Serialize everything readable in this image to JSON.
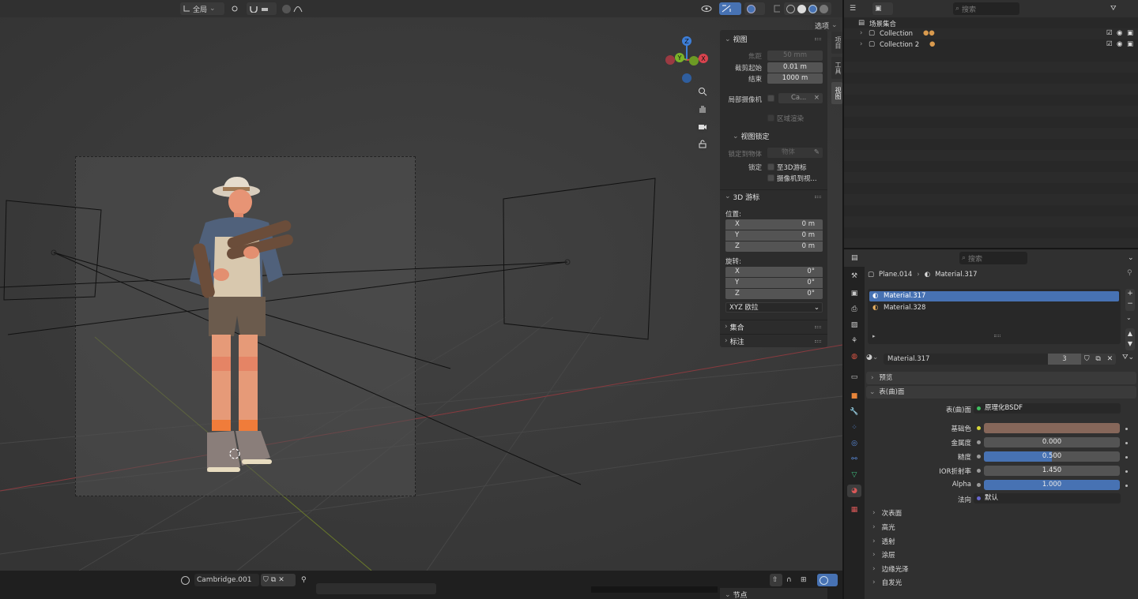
{
  "viewport": {
    "header": {
      "transform_orientation": "全局",
      "options_label": "选项"
    },
    "npanel": {
      "view_section": "视图",
      "focal_label": "焦距",
      "focal_value": "50 mm",
      "clip_start_label": "截剪起始",
      "clip_start_value": "0.01 m",
      "clip_end_label": "结束",
      "clip_end_value": "1000 m",
      "local_camera_label": "局部摄像机",
      "local_camera_value": "Ca...",
      "region_render_label": "区域渲染",
      "view_lock_section": "视图锁定",
      "lock_to_object_label": "锁定到物体",
      "lock_to_object_placeholder": "物体",
      "lock_label": "锁定",
      "lock_to_cursor_label": "至3D游标",
      "camera_to_view_label": "摄像机到视...",
      "cursor_section": "3D 游标",
      "location_label": "位置:",
      "loc_x_key": "X",
      "loc_x_val": "0 m",
      "loc_y_key": "Y",
      "loc_y_val": "0 m",
      "loc_z_key": "Z",
      "loc_z_val": "0 m",
      "rotation_label": "旋转:",
      "rot_x_key": "X",
      "rot_x_val": "0°",
      "rot_y_key": "Y",
      "rot_y_val": "0°",
      "rot_z_key": "Z",
      "rot_z_val": "0°",
      "rotation_mode": "XYZ 欧拉",
      "collection_section": "集合",
      "annotation_section": "标注",
      "node_section": "节点"
    },
    "tabs": [
      "项目",
      "工具",
      "视图"
    ],
    "gizmo": {
      "x": "X",
      "y": "Y",
      "z": "Z"
    },
    "bottom": {
      "world_name": "Cambridge.001"
    }
  },
  "outliner": {
    "search_placeholder": "搜索",
    "scene_collection": "场景集合",
    "items": [
      {
        "label": "Collection"
      },
      {
        "label": "Collection 2"
      }
    ]
  },
  "properties": {
    "search_placeholder": "搜索",
    "breadcrumb_object": "Plane.014",
    "breadcrumb_material": "Material.317",
    "material_slots": [
      "Material.317",
      "Material.328"
    ],
    "material_name": "Material.317",
    "user_count": "3",
    "preview_section": "预览",
    "surface_section": "表(曲)面",
    "surface_label": "表(曲)面",
    "surface_value": "原理化BSDF",
    "base_color_label": "基础色",
    "base_color": "#86675a",
    "metallic_label": "金属度",
    "metallic_value": "0.000",
    "roughness_label": "糙度",
    "roughness_value": "0.500",
    "roughness_fill": 0.5,
    "ior_label": "IOR折射率",
    "ior_value": "1.450",
    "alpha_label": "Alpha",
    "alpha_value": "1.000",
    "normal_label": "法向",
    "normal_value": "默认",
    "subsections": [
      "次表面",
      "高光",
      "透射",
      "涂层",
      "边缘光泽",
      "自发光"
    ],
    "accent_color": "#4772b3"
  }
}
